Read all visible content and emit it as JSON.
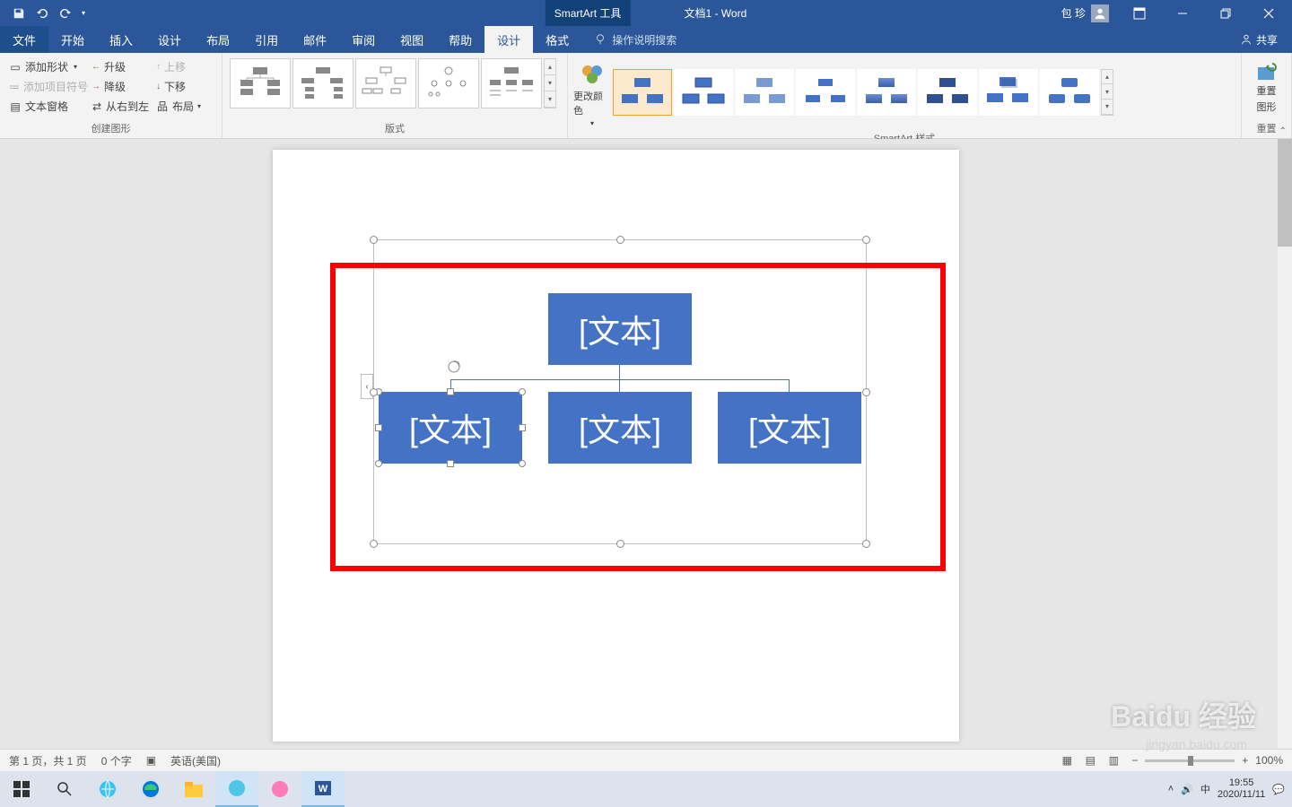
{
  "titlebar": {
    "smartart_tools": "SmartArt 工具",
    "doc_title": "文档1 - Word",
    "username": "包 珍"
  },
  "tabs": {
    "file": "文件",
    "home": "开始",
    "insert": "插入",
    "design_page": "设计",
    "layout": "布局",
    "references": "引用",
    "mailings": "邮件",
    "review": "审阅",
    "view": "视图",
    "help": "帮助",
    "sa_design": "设计",
    "sa_format": "格式",
    "tellme": "操作说明搜索",
    "share": "共享"
  },
  "ribbon": {
    "create": {
      "add_shape": "添加形状",
      "add_bullet": "添加项目符号",
      "text_pane": "文本窗格",
      "promote": "升级",
      "demote": "降级",
      "rtl": "从右到左",
      "move_up": "上移",
      "move_down": "下移",
      "layout_btn": "布局",
      "group_label": "创建图形"
    },
    "layouts": {
      "group_label": "版式"
    },
    "colors": {
      "btn": "更改颜色"
    },
    "styles": {
      "group_label": "SmartArt 样式"
    },
    "reset": {
      "btn_line1": "重置",
      "btn_line2": "图形",
      "group_label": "重置"
    }
  },
  "smartart": {
    "placeholder": "[文本]"
  },
  "statusbar": {
    "page": "第 1 页，共 1 页",
    "words": "0 个字",
    "lang_icon": "",
    "language": "英语(美国)",
    "zoom": "100%"
  },
  "taskbar": {
    "ime": "中",
    "time": "19:55",
    "date": "2020/11/11"
  },
  "watermark": {
    "main": "Baidu 经验",
    "sub": "jingyan.baidu.com"
  }
}
